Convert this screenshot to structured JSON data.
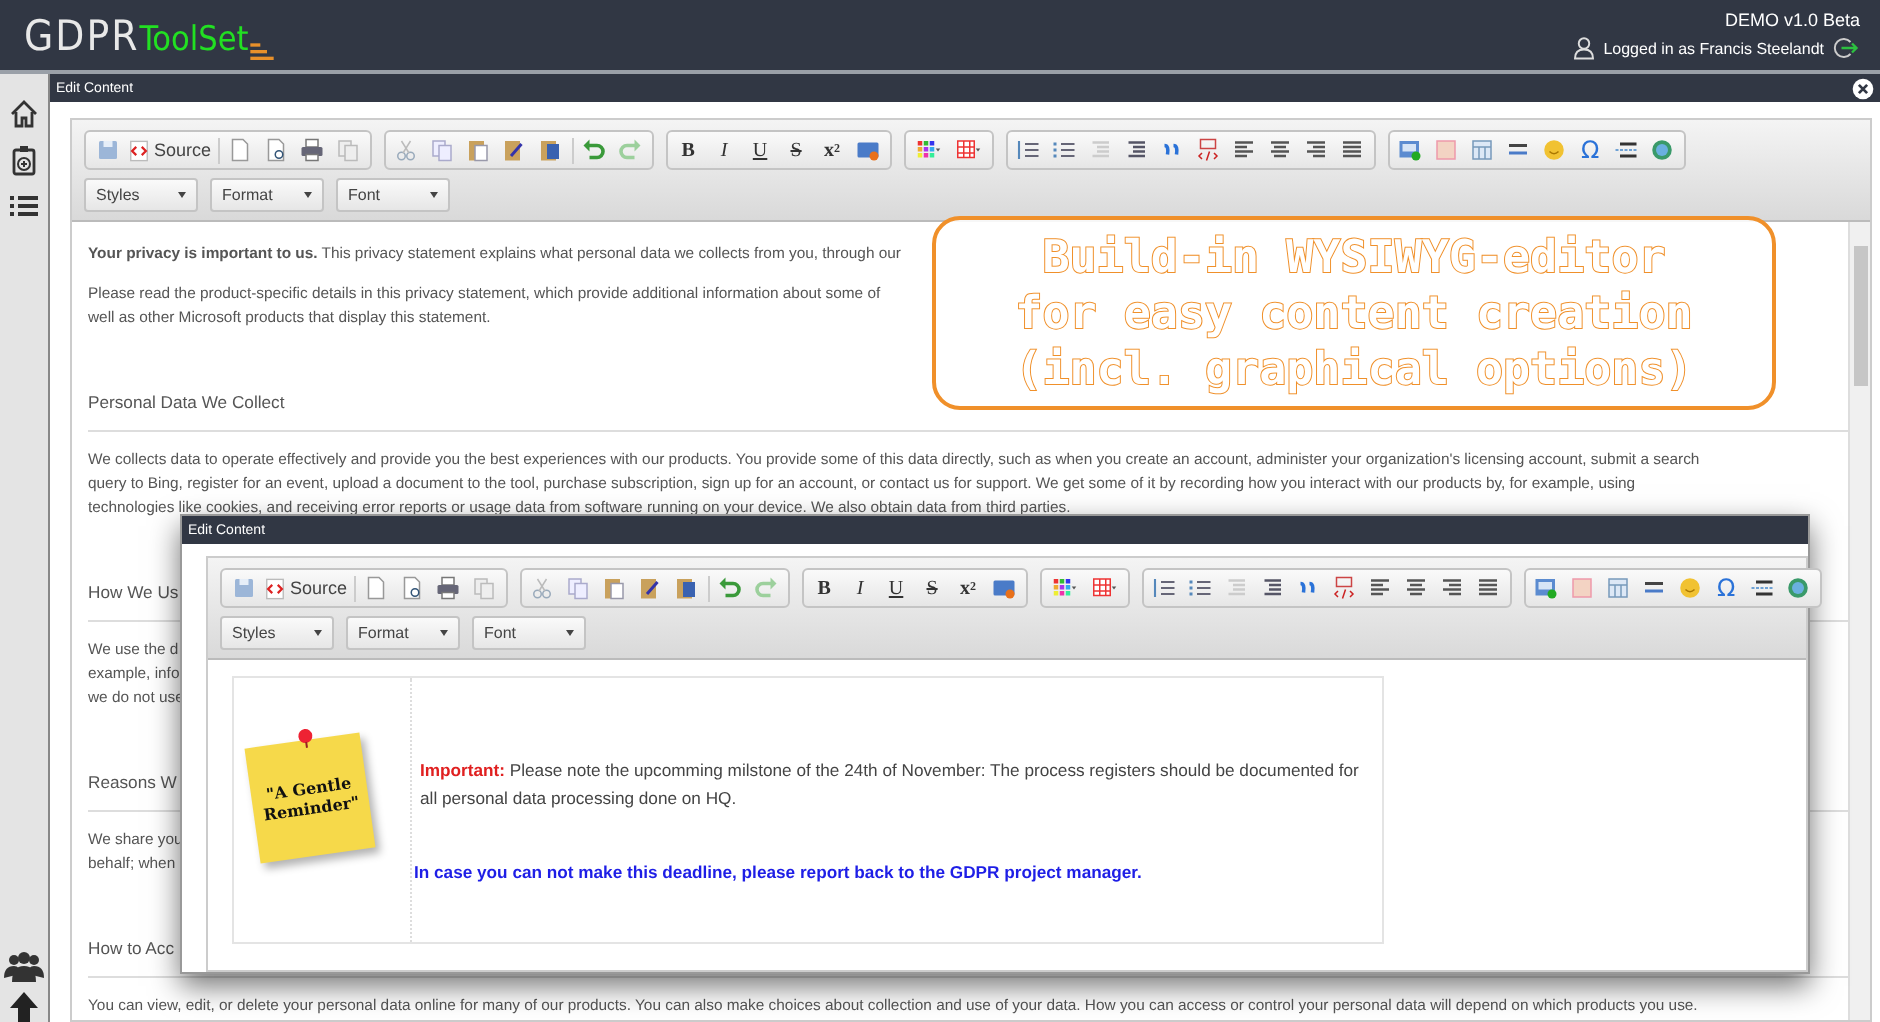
{
  "header": {
    "logo_main": "GDPR",
    "logo_accent": "ToolSet",
    "version": "DEMO v1.0 Beta",
    "user": "Logged in as Francis Steelandt"
  },
  "main_window": {
    "title": "Edit Content",
    "toolbar": {
      "source": "Source",
      "format_keys": [
        "B",
        "I",
        "U",
        "S",
        "x$^{2}$"
      ],
      "special_char": "Ω",
      "dropdowns": [
        "Styles",
        "Format",
        "Font"
      ]
    },
    "document": [
      {
        "kind": "paragraph",
        "lines": [
          "**Your privacy is important to us.** This privacy statement explains what personal data we collects from you, through our"
        ]
      },
      {
        "kind": "paragraph",
        "lines": [
          "Please read the product-specific details in this privacy statement, which provide additional information about some of",
          "well as other Microsoft products that display this statement."
        ]
      },
      {
        "kind": "heading",
        "text": "Personal Data We Collect"
      },
      {
        "kind": "paragraph",
        "lines": [
          "We collects data to operate effectively and provide you the best experiences with our products. You provide some of this data directly, such as when you create an account, administer your organization's licensing account, submit a search",
          "query to Bing, register for an event,  upload a document to the tool, purchase subscription, sign up for an account, or contact us for support. We get some of it by recording how you interact with our products by, for example, using",
          "technologies like cookies, and receiving error reports or usage data from software running on your device. We also obtain data from third parties."
        ]
      },
      {
        "kind": "heading",
        "text": "How We Us"
      },
      {
        "kind": "paragraph",
        "lines": [
          "We use the d",
          "example, info",
          "we do not use"
        ]
      },
      {
        "kind": "heading",
        "text": "Reasons W"
      },
      {
        "kind": "paragraph",
        "lines": [
          "We share you",
          "behalf; when"
        ]
      },
      {
        "kind": "heading",
        "text": "How to Acc"
      },
      {
        "kind": "paragraph",
        "lines": [
          "You can view, edit, or delete your personal data online for many of our products. You can also make choices about  collection and use of your data. How you can access or control your personal data will depend on which products you use."
        ]
      }
    ]
  },
  "callout": {
    "lines": [
      "Build-in WYSIWYG-editor",
      "for easy content creation",
      "(incl. graphical options)"
    ]
  },
  "overlay_window": {
    "title": "Edit Content",
    "toolbar": {
      "source": "Source",
      "format_keys": [
        "B",
        "I",
        "U",
        "S",
        "x$^{2}$"
      ],
      "special_char": "Ω",
      "dropdowns": [
        "Styles",
        "Format",
        "Font"
      ]
    },
    "note": "\"A Gentle Reminder\"",
    "message": "**Important:** Please note the upcomming milstone of the 24th of November: The process registers should be documented for all personal data processing done on HQ.",
    "followup": "In case you can not make this deadline, please report back to the GDPR project manager."
  }
}
